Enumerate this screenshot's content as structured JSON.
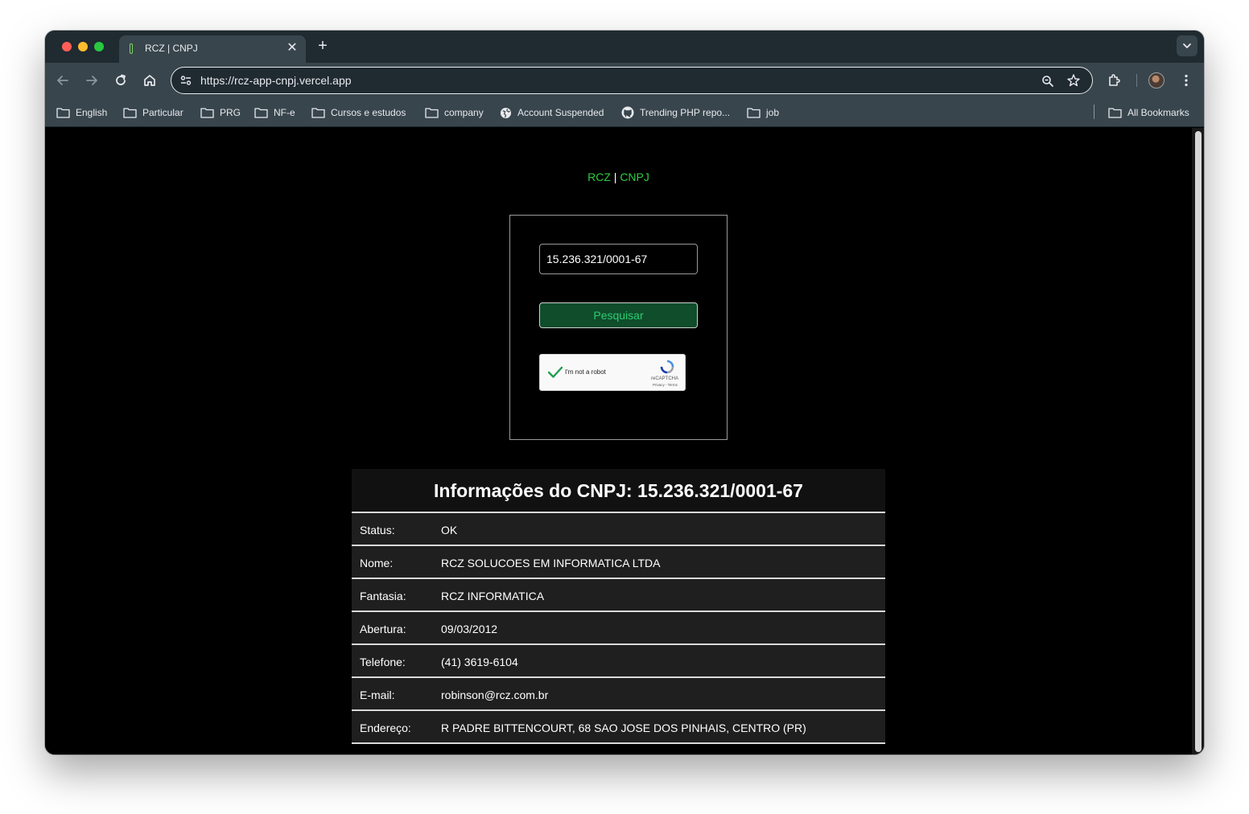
{
  "browser": {
    "tab_title": "RCZ | CNPJ",
    "url": "https://rcz-app-cnpj.vercel.app"
  },
  "bookmarks": [
    {
      "label": "English",
      "icon": "folder-icon"
    },
    {
      "label": "Particular",
      "icon": "folder-icon"
    },
    {
      "label": "PRG",
      "icon": "folder-icon"
    },
    {
      "label": "NF-e",
      "icon": "folder-icon"
    },
    {
      "label": "Cursos e estudos",
      "icon": "folder-icon"
    },
    {
      "label": "company",
      "icon": "folder-icon"
    },
    {
      "label": "Account Suspended",
      "icon": "globe-icon"
    },
    {
      "label": "Trending PHP repo...",
      "icon": "github-icon"
    },
    {
      "label": "job",
      "icon": "folder-icon"
    }
  ],
  "all_bookmarks": "All Bookmarks",
  "page": {
    "brand_left": "RCZ",
    "brand_sep": "|",
    "brand_right": "CNPJ",
    "cnpj_input_value": "15.236.321/0001-67",
    "search_button": "Pesquisar",
    "captcha": {
      "label": "I'm not a robot",
      "brand": "reCAPTCHA",
      "terms": "Privacy - Terms"
    },
    "info": {
      "title": "Informações do CNPJ: 15.236.321/0001-67",
      "rows": [
        {
          "label": "Status:",
          "value": "OK"
        },
        {
          "label": "Nome:",
          "value": "RCZ SOLUCOES EM INFORMATICA LTDA"
        },
        {
          "label": "Fantasia:",
          "value": "RCZ INFORMATICA"
        },
        {
          "label": "Abertura:",
          "value": "09/03/2012"
        },
        {
          "label": "Telefone:",
          "value": "(41) 3619-6104"
        },
        {
          "label": "E-mail:",
          "value": "robinson@rcz.com.br"
        },
        {
          "label": "Endereço:",
          "value": "R PADRE BITTENCOURT, 68 SAO JOSE DOS PINHAIS, CENTRO (PR)"
        }
      ]
    }
  },
  "colors": {
    "brand_green": "#2ecc40",
    "button_bg": "#0f4d2b",
    "button_text": "#2ecc71",
    "chrome_dark": "#1f2a31",
    "chrome_toolbar": "#38454d"
  }
}
